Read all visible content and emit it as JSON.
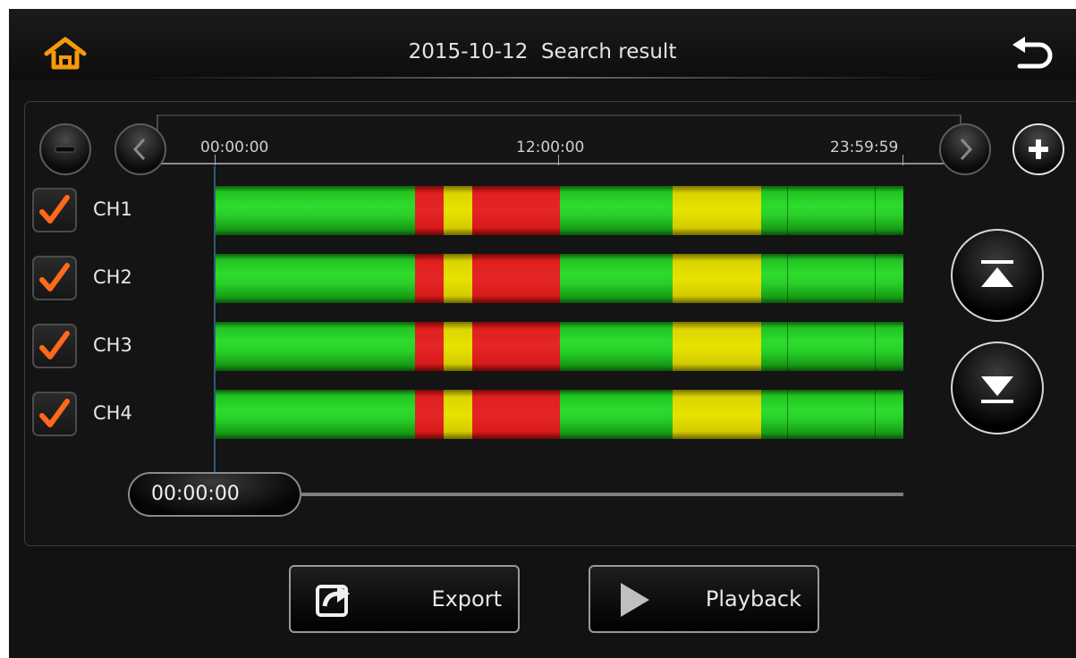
{
  "header": {
    "title": "2015-10-12  Search result",
    "home_icon": "home-icon",
    "back_icon": "back-arrow-icon"
  },
  "timeline": {
    "ticks": [
      "00:00:00",
      "12:00:00",
      "23:59:59"
    ],
    "zoom_out_icon": "minus-icon",
    "zoom_in_icon": "plus-icon",
    "scroll_left_icon": "chevron-left-icon",
    "scroll_right_icon": "chevron-right-icon"
  },
  "channels": [
    {
      "label": "CH1",
      "checked": true
    },
    {
      "label": "CH2",
      "checked": true
    },
    {
      "label": "CH3",
      "checked": true
    },
    {
      "label": "CH4",
      "checked": true
    }
  ],
  "chart_data": {
    "type": "bar",
    "timeline_range_hours": [
      0,
      24
    ],
    "legend_colors": {
      "green": "#2edc2e",
      "red": "#e42626",
      "yellow": "#e8e200"
    },
    "channels": [
      "CH1",
      "CH2",
      "CH3",
      "CH4"
    ],
    "segments": [
      {
        "color": "green",
        "start": 0.0,
        "end": 6.97
      },
      {
        "color": "red",
        "start": 6.97,
        "end": 7.98
      },
      {
        "color": "yellow",
        "start": 7.98,
        "end": 8.98
      },
      {
        "color": "red",
        "start": 8.98,
        "end": 12.03
      },
      {
        "color": "green",
        "start": 12.03,
        "end": 15.97
      },
      {
        "color": "yellow",
        "start": 15.97,
        "end": 19.05
      },
      {
        "color": "green",
        "start": 19.05,
        "end": 24.0
      }
    ],
    "dividers": [
      19.95,
      23.0
    ]
  },
  "playback": {
    "current_time": "00:00:00",
    "position_fraction": 0.0
  },
  "side_buttons": {
    "top_icon": "scroll-to-top-icon",
    "bottom_icon": "scroll-to-bottom-icon"
  },
  "actions": {
    "export_label": "Export",
    "export_icon": "export-icon",
    "playback_label": "Playback",
    "playback_icon": "play-icon"
  },
  "colors": {
    "accent_orange": "#f59a0c",
    "checkmark": "#ff6a1a",
    "background": "#121212"
  }
}
